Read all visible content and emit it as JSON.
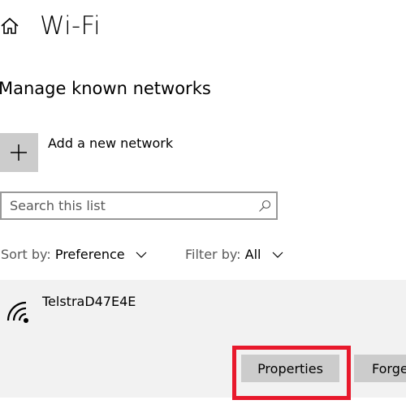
{
  "header": {
    "title": "Wi-Fi",
    "home_icon": "home-icon"
  },
  "section": {
    "heading": "Manage known networks"
  },
  "add_network": {
    "icon": "plus-icon",
    "label": "Add a new network"
  },
  "search": {
    "placeholder": "Search this list",
    "value": "",
    "icon": "search-icon"
  },
  "sort": {
    "label": "Sort by:",
    "value": "Preference"
  },
  "filter": {
    "label": "Filter by:",
    "value": "All"
  },
  "networks": [
    {
      "name": "TelstraD47E4E",
      "icon": "wifi-signal-icon",
      "properties_label": "Properties",
      "forget_label": "Forget"
    }
  ],
  "colors": {
    "highlight": "#e8192c",
    "button_bg": "#cccccc",
    "item_bg": "#f2f2f2",
    "search_border": "#999999"
  }
}
